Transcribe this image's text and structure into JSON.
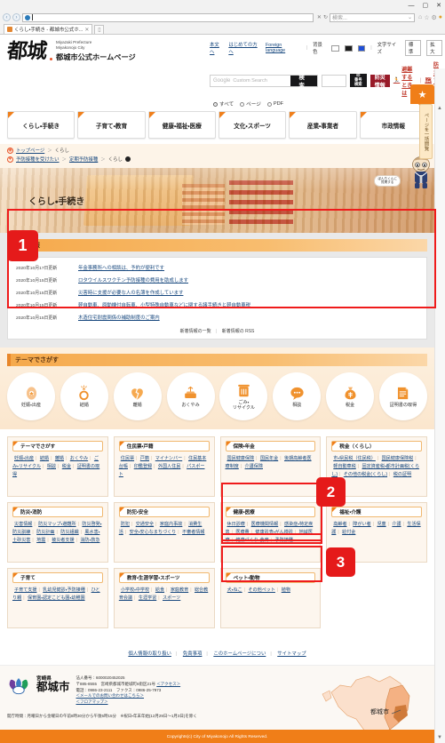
{
  "browser": {
    "tab_title": "くらし・手続き - 都城市公式ホ...",
    "tab_close": "✕",
    "new_tab": "▯",
    "address_value": "",
    "search_placeholder": "検索...",
    "back_icon": "‹",
    "forward_icon": "›",
    "refresh_icon": "↻",
    "stop_icon": "✕",
    "minimize": "—",
    "maximize": "▢",
    "close": "✕",
    "home_icon": "⌂",
    "fav_icon": "☆",
    "tools_icon": "⚙",
    "user_icon": "●",
    "search_glass": "🔍"
  },
  "header": {
    "logo_mark": "都城",
    "org_en_line1": "Miyazaki Prefecture",
    "org_en_line2": "Miyakonojo City",
    "org_jp": "都城市公式ホームページ",
    "util_links": [
      "本文へ",
      "はじめての方へ",
      "Foreign language"
    ],
    "bgcolor_label": "背景色",
    "bgcolor_options": [
      "白",
      "黒",
      "青"
    ],
    "fontsize_label": "文字サイズ",
    "fontsize_options": [
      "標準",
      "拡大"
    ],
    "google_logo": "Google",
    "search_placeholder": "Custom Search",
    "search_button": "検索",
    "id_input_value": "",
    "id_button_line1": "ID",
    "id_button_line2": "番号検索",
    "bousai_button": "防災情報",
    "hinan_link": "避難するときは",
    "bousai_map_link": "防災マップ",
    "radio_options": [
      "すべて",
      "ページ",
      "PDF"
    ],
    "radio_selected": "すべて"
  },
  "gnav": [
    "くらし・手続き",
    "子育て・教育",
    "健康・福祉・医療",
    "文化・スポーツ",
    "産業・事業者",
    "市政情報"
  ],
  "breadcrumbs": {
    "row1": [
      "トップページ",
      "くらし"
    ],
    "row2": [
      "予防接種を受けたい",
      "定期予防接種",
      "くらし"
    ],
    "arrow": "＞"
  },
  "hero": {
    "title": "くらし・手続き",
    "bubble_line1": "ぼんちくんに",
    "bubble_line2": "質問する"
  },
  "news": {
    "heading": "新着情報",
    "items": [
      {
        "date": "2020年10月17日更新",
        "title": "年金事務所への相談は、予約が便利です"
      },
      {
        "date": "2020年10月15日更新",
        "title": "ロタウイルスワクチン予防接種の費用を助成します"
      },
      {
        "date": "2020年10月15日更新",
        "title": "災害時に支援が必要な人の名簿を作成しています"
      },
      {
        "date": "2020年10月15日更新",
        "title": "軽自動車、原動機付自転車、小型特殊自動車などに関する諸手続きと軽自動車税"
      },
      {
        "date": "2020年10月15日更新",
        "title": "木造住宅耐震関係の補助制度のご案内"
      }
    ],
    "footer_list": "新着情報の一覧",
    "footer_rss": "新着情報の RSS"
  },
  "theme": {
    "heading": "テーマでさがす",
    "items": [
      {
        "label": "妊娠・出産",
        "icon": "pregnancy-icon"
      },
      {
        "label": "結婚",
        "icon": "ring-icon"
      },
      {
        "label": "離婚",
        "icon": "broken-heart-icon"
      },
      {
        "label": "おくやみ",
        "icon": "funeral-icon"
      },
      {
        "label": "ごみ・\nリサイクル",
        "icon": "trash-icon"
      },
      {
        "label": "相談",
        "icon": "speech-bubble-icon"
      },
      {
        "label": "税金",
        "icon": "money-bag-icon"
      },
      {
        "label": "証明書の取得",
        "icon": "document-icon"
      }
    ]
  },
  "categories": [
    [
      {
        "title": "テーマでさがす",
        "links": [
          "妊娠・出産",
          "結婚",
          "離婚",
          "おくやみ",
          "ごみ・リサイクル",
          "相談",
          "税金",
          "証明書の取得"
        ]
      },
      {
        "title": "住民票・戸籍",
        "links": [
          "住民票",
          "戸籍",
          "マイナンバー",
          "住民基本台帳",
          "印鑑登録",
          "外国人住民",
          "パスポート"
        ]
      },
      {
        "title": "保険・年金",
        "links": [
          "国民健康保険",
          "国民年金",
          "後期高齢者医療制度",
          "介護保険"
        ]
      },
      {
        "title": "税金（くらし）",
        "links": [
          "市・県民税（住民税）",
          "国民健康保険税",
          "軽自動車税",
          "固定資産税・都市計画税(くらし)",
          "その他の税金(くらし)",
          "税の証明"
        ]
      }
    ],
    [
      {
        "title": "防災・消防",
        "links": [
          "災害情報",
          "防災マップ・避難所",
          "防災啓発・防災訓練",
          "防災計画",
          "防災組織",
          "風水害・土砂災害",
          "地震",
          "被災者支援",
          "消防・救急"
        ]
      },
      {
        "title": "防犯・安全",
        "links": [
          "防犯",
          "交通安全",
          "家庭内事故",
          "消費生活",
          "安全・安心なまちづくり",
          "不審者情報"
        ]
      },
      {
        "title": "健康・医療",
        "links": [
          "休日診療",
          "医療機関情報",
          "感染症・特定疾患",
          "医療費",
          "健康診査・がん検診",
          "地域医療",
          "健康づくり・食育",
          "予防接種"
        ]
      },
      {
        "title": "福祉・介護",
        "links": [
          "高齢者",
          "障がい者",
          "児童",
          "介護",
          "生活保護",
          "給付金"
        ]
      }
    ],
    [
      {
        "title": "子育て",
        "links": [
          "子育て支援",
          "乳幼児健診・予防接種",
          "ひとり親",
          "保育園・認定こども園・幼稚園"
        ]
      },
      {
        "title": "教育・生涯学習・スポーツ",
        "links": [
          "小学校・中学校",
          "給食",
          "家庭教育",
          "総合教育会議",
          "生涯学習",
          "スポーツ"
        ]
      },
      {
        "title": "ペット・動物",
        "links": [
          "犬・ねこ",
          "その他ペット",
          "植物"
        ]
      }
    ]
  ],
  "footer": {
    "links": [
      "個人情報の取り扱い",
      "免責事項",
      "このホームページについ",
      "サイトマップ"
    ],
    "pref_name": "宮崎県",
    "city_name": "都城市",
    "corp_number": "法人番号：6000020452025",
    "address": "〒885-8555　宮崎県都城市姫城町6街区21号",
    "access_link": "＜アクセス＞",
    "tel": "電話：0986-23-2111　ファクス：0986-25-7973",
    "mail_link": "＜メールでのお問い合わせはこちら＞",
    "floormap_link": "＜フロアマップ＞",
    "hours": "開庁時間：月曜日から金曜日の午前8時30分から午後5時15分　※祝日・年末年始(12月29日～1月3日)を除く",
    "map_label": "都城市",
    "copyright": "Copyrights(c) City of Miyakonojo All Rights Reserved."
  },
  "rail": {
    "fab_icon": "★",
    "side_tab": "ページを一括閲覧",
    "scroll_up": "▲",
    "scroll_down": "▼"
  },
  "annotations": [
    {
      "num": "1"
    },
    {
      "num": "2"
    },
    {
      "num": "3"
    }
  ]
}
